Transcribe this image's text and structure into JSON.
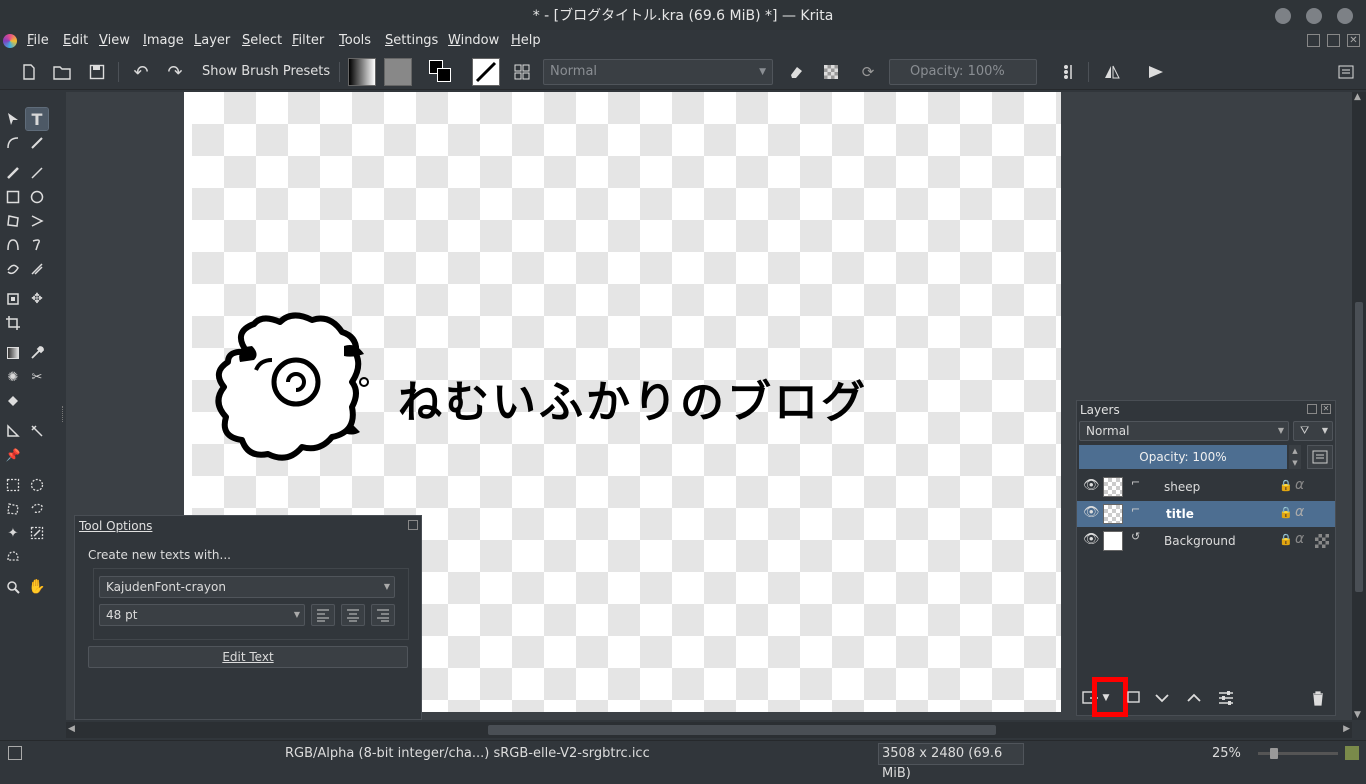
{
  "window": {
    "title": "* - [ブログタイトル.kra (69.6 MiB) *] — Krita"
  },
  "menubar": {
    "items": [
      {
        "label": "File",
        "ul": "F",
        "rest": "ile"
      },
      {
        "label": "Edit",
        "ul": "E",
        "rest": "dit"
      },
      {
        "label": "View",
        "ul": "V",
        "rest": "iew"
      },
      {
        "label": "Image",
        "ul": "I",
        "rest": "mage"
      },
      {
        "label": "Layer",
        "ul": "L",
        "rest": "ayer"
      },
      {
        "label": "Select",
        "ul": "S",
        "rest": "elect"
      },
      {
        "label": "Filter",
        "ul": "F",
        "rest": "ilter"
      },
      {
        "label": "Tools",
        "ul": "T",
        "rest": "ools"
      },
      {
        "label": "Settings",
        "ul": "S",
        "rest": "ettings"
      },
      {
        "label": "Window",
        "ul": "W",
        "rest": "indow"
      },
      {
        "label": "Help",
        "ul": "H",
        "rest": "elp"
      }
    ]
  },
  "toolbar": {
    "brush_presets_label": "Show Brush Presets",
    "blend_mode": "Normal",
    "opacity": "Opacity:  100%"
  },
  "canvas": {
    "title_text": "ねむいふかりのブログ"
  },
  "tool_options": {
    "title": "Tool Options",
    "create_label": "Create new texts with...",
    "font": "KajudenFont-crayon",
    "size": "48 pt",
    "edit_text_button": "Edit Text"
  },
  "layers": {
    "title": "Layers",
    "blend_mode": "Normal",
    "opacity": "Opacity:  100%",
    "items": [
      {
        "name": "sheep",
        "selected": false
      },
      {
        "name": "title",
        "selected": true
      },
      {
        "name": "Background",
        "selected": false
      }
    ]
  },
  "statusbar": {
    "color_profile": "RGB/Alpha (8-bit integer/cha...)  sRGB-elle-V2-srgbtrc.icc",
    "dimensions": "3508 x 2480 (69.6 MiB)",
    "zoom": "25%"
  },
  "colors": {
    "accent": "#4d6e91",
    "highlight_box": "#ff0000"
  }
}
